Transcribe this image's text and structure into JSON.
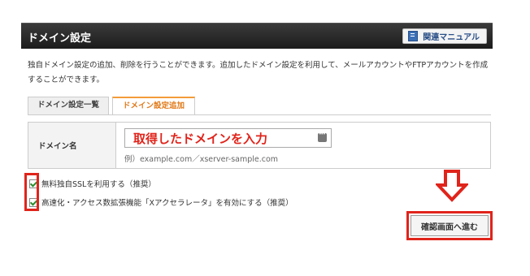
{
  "header": {
    "title": "ドメイン設定",
    "manual_label": "関連マニュアル",
    "manual_icon": "book-icon"
  },
  "description": "独自ドメイン設定の追加、削除を行うことができます。追加したドメイン設定を利用して、メールアカウントやFTPアカウントを作成することができます。",
  "tabs": [
    {
      "label": "ドメイン設定一覧",
      "active": false
    },
    {
      "label": "ドメイン設定追加",
      "active": true
    }
  ],
  "form": {
    "domain_label": "ドメイン名",
    "domain_value": "取得したドメインを入力",
    "example": "例）example.com／xserver-sample.com"
  },
  "options": [
    {
      "label": "無料独自SSLを利用する（推奨）",
      "checked": true
    },
    {
      "label": "高速化・アクセス数拡張機能「Xアクセラレータ」を有効にする（推奨）",
      "checked": true
    }
  ],
  "confirm_label": "確認画面へ進む",
  "colors": {
    "annotation_red": "#e0241b",
    "tab_active": "#e07a1a",
    "header_bg": "#2a2a2a"
  }
}
